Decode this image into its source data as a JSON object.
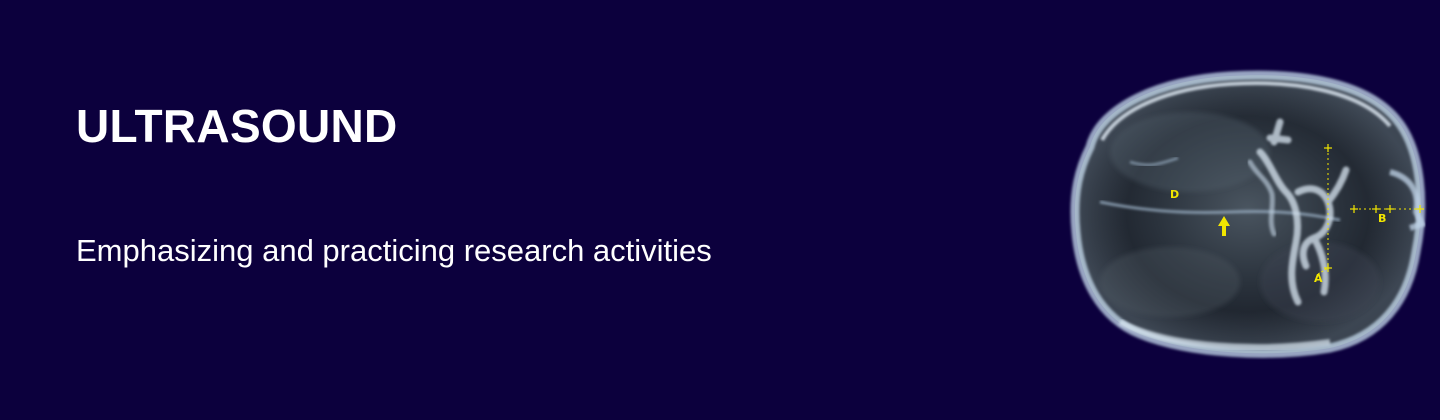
{
  "banner": {
    "title": "ULTRASOUND",
    "subtitle": "Emphasizing and practicing research activities",
    "colors": {
      "background": "#0c003d",
      "text": "#ffffff",
      "marker": "#f2e600"
    }
  },
  "scan_image": {
    "icon": "ultrasound-brain-scan",
    "markers": [
      {
        "label": "D"
      },
      {
        "label": "B"
      },
      {
        "label": "A"
      }
    ]
  }
}
